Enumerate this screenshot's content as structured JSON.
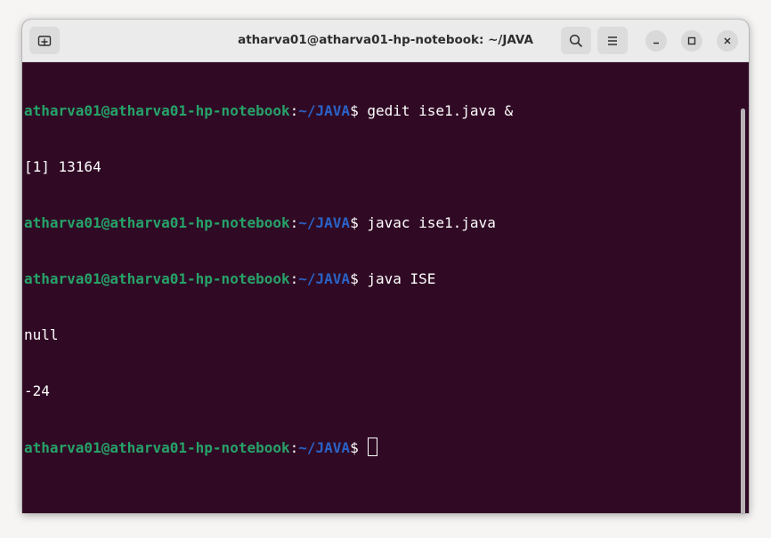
{
  "window": {
    "title": "atharva01@atharva01-hp-notebook: ~/JAVA"
  },
  "header": {
    "new_tab_icon": "new-tab-icon",
    "search_icon": "search-icon",
    "menu_icon": "hamburger-menu-icon",
    "minimize_icon": "minimize-icon",
    "maximize_icon": "maximize-icon",
    "close_icon": "close-icon"
  },
  "terminal": {
    "prompt_user": "atharva01@atharva01-hp-notebook",
    "prompt_colon": ":",
    "prompt_path": "~/JAVA",
    "prompt_symbol": "$ ",
    "lines": [
      {
        "type": "prompt",
        "command": "gedit ise1.java &"
      },
      {
        "type": "output",
        "text": "[1] 13164"
      },
      {
        "type": "prompt",
        "command": "javac ise1.java"
      },
      {
        "type": "prompt",
        "command": "java ISE"
      },
      {
        "type": "output",
        "text": "null"
      },
      {
        "type": "output",
        "text": "-24"
      },
      {
        "type": "prompt",
        "command": ""
      }
    ]
  },
  "colors": {
    "background": "#300a24",
    "user": "#26a269",
    "path": "#2a62c7",
    "text": "#ffffff"
  }
}
